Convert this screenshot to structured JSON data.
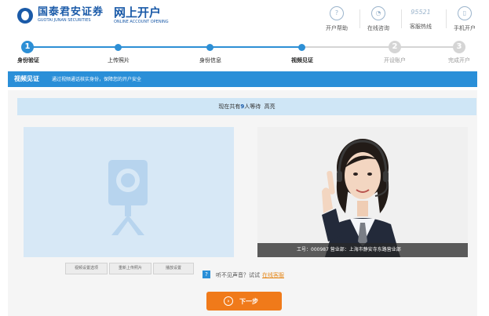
{
  "brand": {
    "name_cn": "国泰君安证券",
    "name_en": "GUOTAI JUNAN SECURITIES",
    "sub_cn": "网上开户",
    "sub_en": "ONLINE ACCOUNT OPENING"
  },
  "nav": [
    {
      "label": "开户帮助",
      "icon": "help-icon"
    },
    {
      "label": "在线咨询",
      "icon": "chat-icon"
    },
    {
      "label": "客服热线",
      "icon": "phone-icon",
      "icon_text": "95521"
    },
    {
      "label": "手机开户",
      "icon": "mobile-icon"
    }
  ],
  "steps": [
    {
      "num": "1",
      "label": "身份验证",
      "state": "active"
    },
    {
      "label": "上传照片",
      "state": "done"
    },
    {
      "label": "身份信息",
      "state": "done"
    },
    {
      "label": "视频见证",
      "state": "current"
    },
    {
      "num": "2",
      "label": "开设账户",
      "state": "pending"
    },
    {
      "num": "3",
      "label": "完成开户",
      "state": "pending"
    }
  ],
  "banner": {
    "title": "视频见证",
    "desc": "通过视频通话核实身份，保障您的开户安全"
  },
  "queue": {
    "prefix": "现在共有",
    "count": "9",
    "suffix": "人等待",
    "status": "高亮"
  },
  "camera_controls": [
    "视频设置选项",
    "重新上传照片",
    "播放设置"
  ],
  "agent_caption": "工号：000987 营业部：上海市静安寺东路营业部",
  "help": {
    "question": "听不见声音？试试",
    "link": "在线客服"
  },
  "next_button": "下一步",
  "colors": {
    "primary": "#2a8fd8",
    "brand": "#1a5aa8",
    "accent": "#f07a1a",
    "queue_bg": "#cfe6f6"
  }
}
